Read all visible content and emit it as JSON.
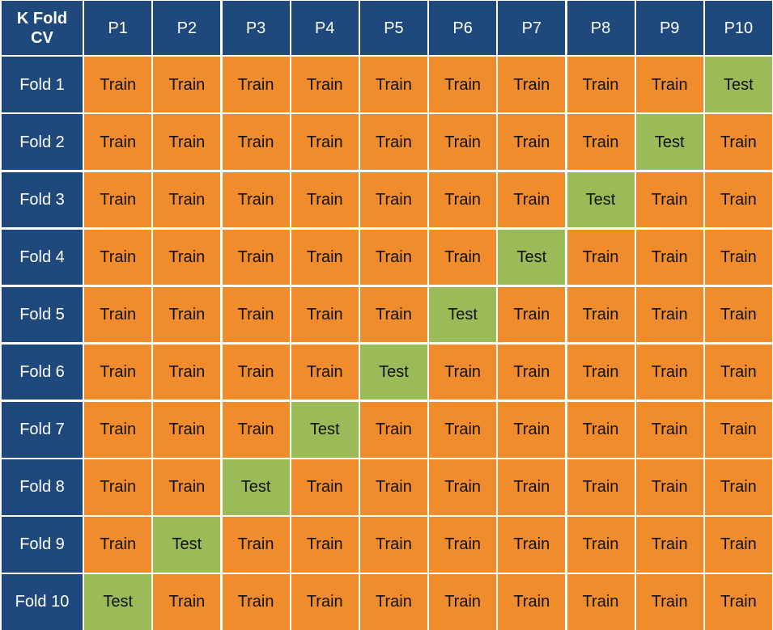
{
  "title": "K Fold CV",
  "corner": {
    "line1": "K Fold",
    "line2": "CV"
  },
  "columns": [
    "P1",
    "P2",
    "P3",
    "P4",
    "P5",
    "P6",
    "P7",
    "P8",
    "P9",
    "P10"
  ],
  "labels": {
    "train": "Train",
    "test": "Test"
  },
  "colors": {
    "header": "#1F497D",
    "train": "#F08C2B",
    "test": "#9BBB59"
  },
  "rows": [
    {
      "label": "Fold 1",
      "cells": [
        "Train",
        "Train",
        "Train",
        "Train",
        "Train",
        "Train",
        "Train",
        "Train",
        "Train",
        "Test"
      ]
    },
    {
      "label": "Fold 2",
      "cells": [
        "Train",
        "Train",
        "Train",
        "Train",
        "Train",
        "Train",
        "Train",
        "Train",
        "Test",
        "Train"
      ]
    },
    {
      "label": "Fold 3",
      "cells": [
        "Train",
        "Train",
        "Train",
        "Train",
        "Train",
        "Train",
        "Train",
        "Test",
        "Train",
        "Train"
      ]
    },
    {
      "label": "Fold 4",
      "cells": [
        "Train",
        "Train",
        "Train",
        "Train",
        "Train",
        "Train",
        "Test",
        "Train",
        "Train",
        "Train"
      ]
    },
    {
      "label": "Fold 5",
      "cells": [
        "Train",
        "Train",
        "Train",
        "Train",
        "Train",
        "Test",
        "Train",
        "Train",
        "Train",
        "Train"
      ]
    },
    {
      "label": "Fold 6",
      "cells": [
        "Train",
        "Train",
        "Train",
        "Train",
        "Test",
        "Train",
        "Train",
        "Train",
        "Train",
        "Train"
      ]
    },
    {
      "label": "Fold 7",
      "cells": [
        "Train",
        "Train",
        "Train",
        "Test",
        "Train",
        "Train",
        "Train",
        "Train",
        "Train",
        "Train"
      ]
    },
    {
      "label": "Fold 8",
      "cells": [
        "Train",
        "Train",
        "Test",
        "Train",
        "Train",
        "Train",
        "Train",
        "Train",
        "Train",
        "Train"
      ]
    },
    {
      "label": "Fold 9",
      "cells": [
        "Train",
        "Test",
        "Train",
        "Train",
        "Train",
        "Train",
        "Train",
        "Train",
        "Train",
        "Train"
      ]
    },
    {
      "label": "Fold 10",
      "cells": [
        "Test",
        "Train",
        "Train",
        "Train",
        "Train",
        "Train",
        "Train",
        "Train",
        "Train",
        "Train"
      ]
    }
  ]
}
